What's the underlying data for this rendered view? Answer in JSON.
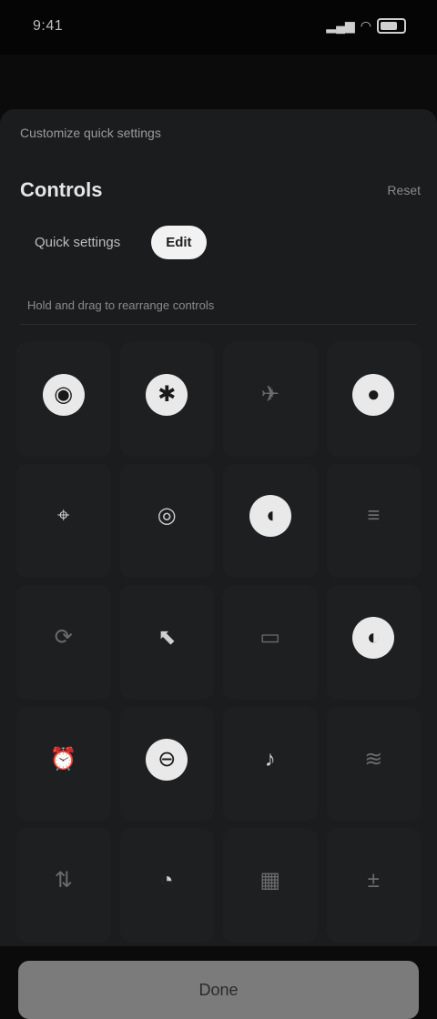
{
  "status": {
    "time": "9:41",
    "signal": "▂▄▆",
    "wifi": "◠"
  },
  "header": {
    "crumb": "Customize quick settings",
    "title": "Controls",
    "action": "Reset"
  },
  "tabs": [
    {
      "label": "Quick settings",
      "active": false
    },
    {
      "label": "Edit",
      "active": true
    }
  ],
  "hint": "Hold and drag to rearrange controls",
  "grid": [
    {
      "icon": "wifi-icon",
      "glyph": "◉",
      "label": "",
      "style": "hi"
    },
    {
      "icon": "bluetooth-icon",
      "glyph": "✱",
      "label": "",
      "style": "hi"
    },
    {
      "icon": "airplane-icon",
      "glyph": "✈",
      "label": "",
      "style": "dim"
    },
    {
      "icon": "flashlight-icon",
      "glyph": "●",
      "label": "",
      "style": "hi"
    },
    {
      "icon": "location-icon",
      "glyph": "⌖",
      "label": "",
      "style": ""
    },
    {
      "icon": "hotspot-icon",
      "glyph": "◎",
      "label": "",
      "style": ""
    },
    {
      "icon": "battery-icon",
      "glyph": "◖",
      "label": "",
      "style": "hi"
    },
    {
      "icon": "nfc-icon",
      "glyph": "≡",
      "label": "",
      "style": "dim"
    },
    {
      "icon": "rotate-icon",
      "glyph": "⟳",
      "label": "",
      "style": "dim"
    },
    {
      "icon": "screen-record-icon",
      "glyph": "⬉",
      "label": "",
      "style": ""
    },
    {
      "icon": "cast-icon",
      "glyph": "▭",
      "label": "",
      "style": "dim"
    },
    {
      "icon": "dark-mode-icon",
      "glyph": "◐",
      "label": "",
      "style": "hi"
    },
    {
      "icon": "alarm-icon",
      "glyph": "⏰",
      "label": "",
      "style": "dim"
    },
    {
      "icon": "dnd-icon",
      "glyph": "⊖",
      "label": "",
      "style": "hi"
    },
    {
      "icon": "sound-icon",
      "glyph": "♪",
      "label": "",
      "style": ""
    },
    {
      "icon": "vibrate-icon",
      "glyph": "≋",
      "label": "",
      "style": "dim"
    },
    {
      "icon": "data-saver-icon",
      "glyph": "⇅",
      "label": "",
      "style": "dim"
    },
    {
      "icon": "eye-comfort-icon",
      "glyph": "◔",
      "label": "",
      "style": ""
    },
    {
      "icon": "qr-scan-icon",
      "glyph": "▦",
      "label": "",
      "style": "dim"
    },
    {
      "icon": "calculator-icon",
      "glyph": "±",
      "label": "",
      "style": "dim"
    }
  ],
  "footer": {
    "label": "Done"
  }
}
